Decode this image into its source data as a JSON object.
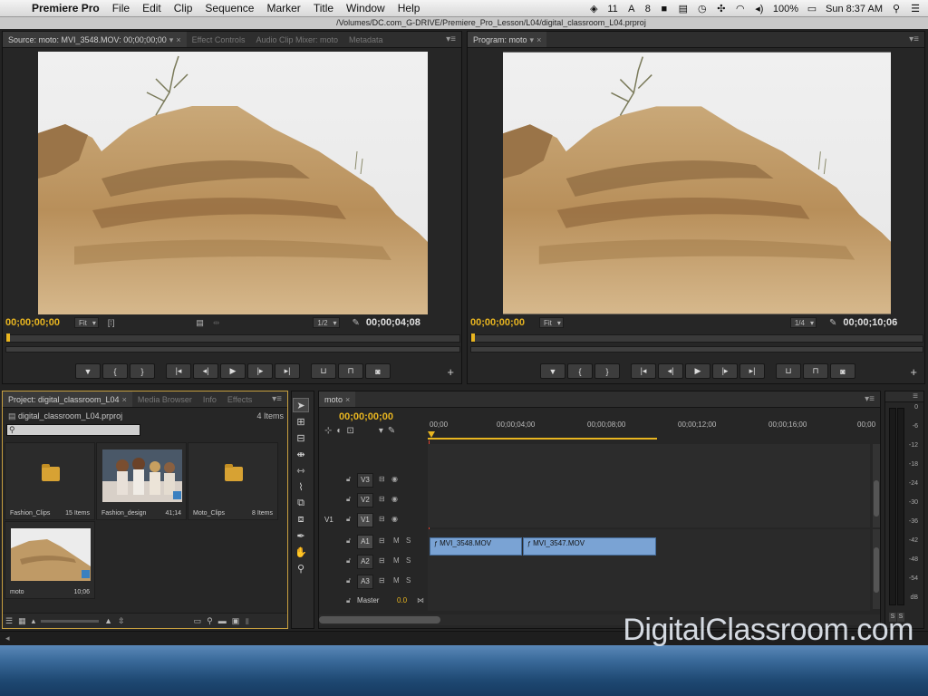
{
  "menubar": {
    "app": "Premiere Pro",
    "items": [
      "File",
      "Edit",
      "Clip",
      "Sequence",
      "Marker",
      "Title",
      "Window",
      "Help"
    ],
    "status_a": "11",
    "status_b": "8",
    "battery": "100%",
    "clock": "Sun 8:37 AM"
  },
  "title": "/Volumes/DC.com_G-DRIVE/Premiere_Pro_Lesson/L04/digital_classroom_L04.prproj",
  "source": {
    "tabs": [
      "Source: moto: MVI_3548.MOV: 00;00;00;00",
      "Effect Controls",
      "Audio Clip Mixer: moto",
      "Metadata"
    ],
    "tc_in": "00;00;00;00",
    "fit": "Fit",
    "res": "1/2",
    "tc_dur": "00;00;04;08"
  },
  "program": {
    "tab": "Program: moto",
    "tc_in": "00;00;00;00",
    "fit": "Fit",
    "res": "1/4",
    "tc_dur": "00;00;10;06"
  },
  "project": {
    "tabs": [
      "Project: digital_classroom_L04",
      "Media Browser",
      "Info",
      "Effects"
    ],
    "file": "digital_classroom_L04.prproj",
    "count": "4 Items",
    "search_placeholder": "",
    "bins": [
      {
        "name": "Fashion_Clips",
        "info": "15 Items"
      },
      {
        "name": "Fashion_design",
        "info": "41;14"
      },
      {
        "name": "Moto_Clips",
        "info": "8 Items"
      },
      {
        "name": "moto",
        "info": "10;06"
      }
    ]
  },
  "timeline": {
    "tab": "moto",
    "timecode": "00;00;00;00",
    "ruler": [
      "00;00",
      "00;00;04;00",
      "00;00;08;00",
      "00;00;12;00",
      "00;00;16;00",
      "00;00"
    ],
    "video_tracks": [
      "V3",
      "V2",
      "V1"
    ],
    "source_patch": "V1",
    "audio_tracks": [
      "A1",
      "A2",
      "A3"
    ],
    "master": "Master",
    "master_value": "0.0",
    "mute": "M",
    "solo": "S",
    "clips": [
      "MVI_3548.MOV",
      "MVI_3547.MOV"
    ]
  },
  "meter": {
    "labels": [
      "0",
      "-6",
      "-12",
      "-18",
      "-24",
      "-30",
      "-36",
      "-42",
      "-48",
      "-54",
      "dB"
    ],
    "solo": "S"
  },
  "watermark": "DigitalClassroom.com",
  "colors": {
    "accent_yellow": "#e8b520",
    "clip_blue": "#7aa3d4",
    "playhead": "#e04030"
  }
}
